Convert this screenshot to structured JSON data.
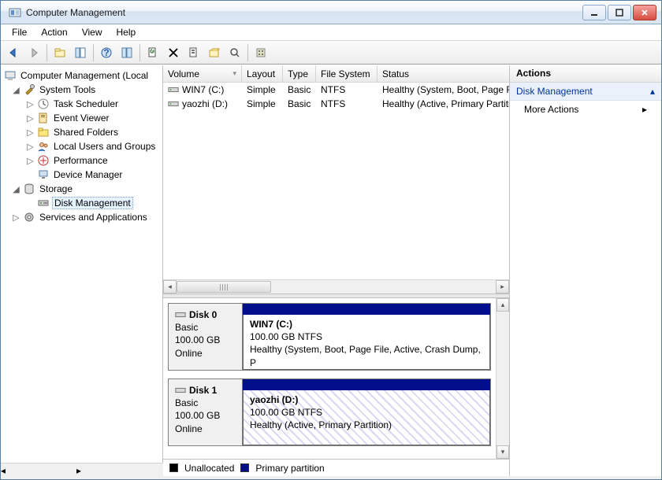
{
  "window": {
    "title": "Computer Management"
  },
  "menubar": {
    "file": "File",
    "action": "Action",
    "view": "View",
    "help": "Help"
  },
  "tree": {
    "root": "Computer Management (Local",
    "system_tools": "System Tools",
    "task_scheduler": "Task Scheduler",
    "event_viewer": "Event Viewer",
    "shared_folders": "Shared Folders",
    "local_users": "Local Users and Groups",
    "performance": "Performance",
    "device_manager": "Device Manager",
    "storage": "Storage",
    "disk_management": "Disk Management",
    "services_apps": "Services and Applications"
  },
  "columns": {
    "volume": "Volume",
    "layout": "Layout",
    "type": "Type",
    "fs": "File System",
    "status": "Status"
  },
  "volumes": [
    {
      "name": "WIN7 (C:)",
      "layout": "Simple",
      "type": "Basic",
      "fs": "NTFS",
      "status": "Healthy (System, Boot, Page File, Ac"
    },
    {
      "name": "yaozhi (D:)",
      "layout": "Simple",
      "type": "Basic",
      "fs": "NTFS",
      "status": "Healthy (Active, Primary Partition)"
    }
  ],
  "disks": [
    {
      "name": "Disk 0",
      "type": "Basic",
      "size": "100.00 GB",
      "state": "Online",
      "part_name": "WIN7  (C:)",
      "part_size": "100.00 GB NTFS",
      "part_status": "Healthy (System, Boot, Page File, Active, Crash Dump, P",
      "hatched": false
    },
    {
      "name": "Disk 1",
      "type": "Basic",
      "size": "100.00 GB",
      "state": "Online",
      "part_name": "yaozhi (D:)",
      "part_size": "100.00 GB NTFS",
      "part_status": "Healthy (Active, Primary Partition)",
      "hatched": true
    }
  ],
  "legend": {
    "unallocated": "Unallocated",
    "primary": "Primary partition"
  },
  "actions": {
    "header": "Actions",
    "section": "Disk Management",
    "more": "More Actions"
  }
}
